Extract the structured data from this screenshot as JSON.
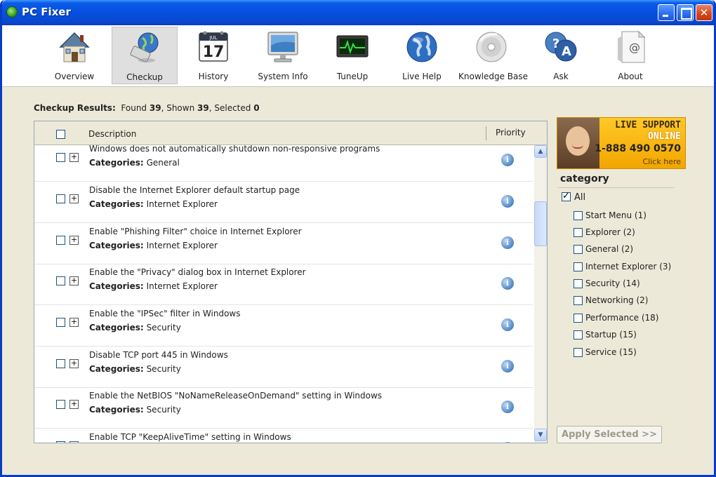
{
  "window": {
    "title": "PC Fixer"
  },
  "toolbar": {
    "items": [
      {
        "label": "Overview",
        "icon": "house-icon"
      },
      {
        "label": "Checkup",
        "icon": "checkup-globe-icon",
        "active": true
      },
      {
        "label": "History",
        "icon": "calendar-icon",
        "calendar_day": "17",
        "calendar_month": "JUL"
      },
      {
        "label": "System Info",
        "icon": "monitor-icon"
      },
      {
        "label": "TuneUp",
        "icon": "heartbeat-monitor-icon"
      },
      {
        "label": "Live Help",
        "icon": "globe-icon"
      },
      {
        "label": "Knowledge Base",
        "icon": "disc-icon"
      },
      {
        "label": "Ask",
        "icon": "question-answer-icon",
        "q": "?",
        "a": "A"
      },
      {
        "label": "About",
        "icon": "document-at-icon",
        "at": "@"
      }
    ]
  },
  "results": {
    "label": "Checkup Results:",
    "found_label": "Found",
    "found": "39",
    "shown_label": ", Shown",
    "shown": "39",
    "selected_label": ", Selected",
    "selected": "0"
  },
  "list": {
    "col_description": "Description",
    "col_priority": "Priority",
    "category_prefix": "Categories:",
    "rows": [
      {
        "description": "Windows does not automatically shutdown non-responsive programs",
        "category": "General"
      },
      {
        "description": "Disable the Internet Explorer default startup page",
        "category": "Internet Explorer"
      },
      {
        "description": "Enable \"Phishing Filter\" choice in Internet Explorer",
        "category": "Internet Explorer"
      },
      {
        "description": "Enable the \"Privacy\" dialog box in Internet Explorer",
        "category": "Internet Explorer"
      },
      {
        "description": "Enable the \"IPSec\" filter in Windows",
        "category": "Security"
      },
      {
        "description": "Disable TCP port 445 in Windows",
        "category": "Security"
      },
      {
        "description": "Enable the NetBIOS \"NoNameReleaseOnDemand\" setting in Windows",
        "category": "Security"
      },
      {
        "description": "Enable TCP \"KeepAliveTime\" setting in Windows",
        "category": ""
      }
    ]
  },
  "ad": {
    "line1": "LIVE SUPPORT",
    "line2": "ONLINE",
    "phone": "1-888 490 0570",
    "cta": "Click here"
  },
  "categories": {
    "title": "category",
    "all_label": "All",
    "items": [
      {
        "label": "Start Menu (1)"
      },
      {
        "label": "Explorer (2)"
      },
      {
        "label": "General (2)"
      },
      {
        "label": "Internet Explorer (3)"
      },
      {
        "label": "Security (14)"
      },
      {
        "label": "Networking (2)"
      },
      {
        "label": "Performance (18)"
      },
      {
        "label": "Startup (15)"
      },
      {
        "label": "Service (15)"
      }
    ]
  },
  "apply_button": "Apply Selected >>",
  "colors": {
    "title_bar": "#0a5ce8",
    "window_bg": "#ece9d8",
    "ad_bg": "#f2a500"
  }
}
